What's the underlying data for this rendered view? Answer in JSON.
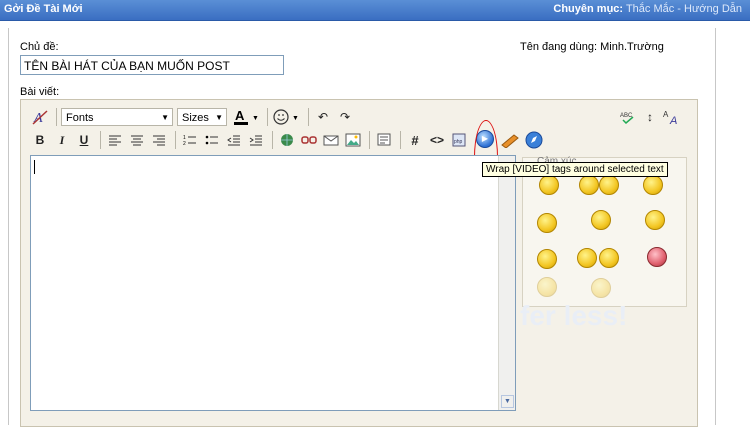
{
  "header": {
    "title": "Gởi Đề Tài Mới",
    "category_label": "Chuyên mục:",
    "category_value": "Thắc Mắc - Hướng Dẫn"
  },
  "form": {
    "subject_label": "Chủ đề:",
    "subject_value": "TÊN BÀI HÁT CỦA BẠN MUỐN POST",
    "user_label": "Tên đang dùng:",
    "user_value": "Minh.Trường",
    "message_label": "Bài viết:"
  },
  "toolbar": {
    "font_select": "Fonts",
    "size_select": "Sizes"
  },
  "smilies": {
    "header": "Cảm xúc"
  },
  "tooltip": "Wrap [VIDEO] tags around selected text",
  "watermark": "fer less!"
}
